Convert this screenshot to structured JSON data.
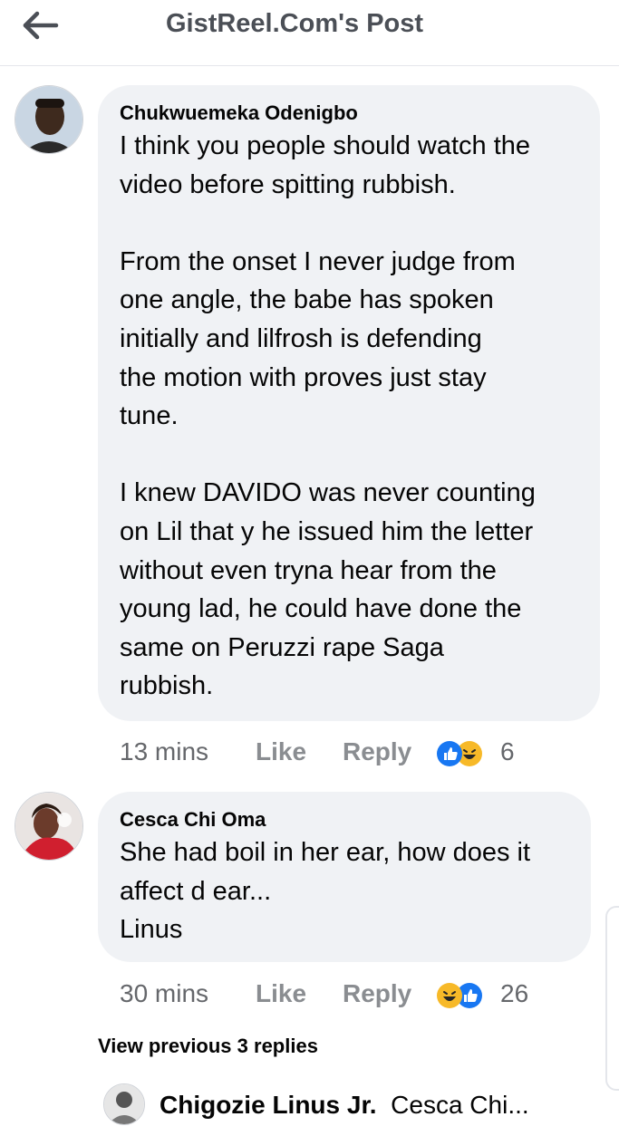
{
  "header": {
    "title": "GistReel.Com's Post"
  },
  "comments": [
    {
      "author": "Chukwuemeka Odenigbo",
      "text": "I think you people should watch the\nvideo before spitting rubbish.\n\nFrom the onset I never judge from\none angle, the babe has spoken\ninitially and lilfrosh is defending\nthe motion with proves just stay\ntune.\n\nI knew DAVIDO was never counting\non Lil that y he issued him the letter\nwithout even tryna hear from the\nyoung lad, he could have done the\nsame on Peruzzi rape Saga\nrubbish.",
      "time": "13 mins",
      "like": "Like",
      "reply": "Reply",
      "reaction_count": "6",
      "reactions": [
        "like-reaction-icon",
        "haha-reaction-icon"
      ]
    },
    {
      "author": "Cesca Chi Oma",
      "text": "She had boil in her ear, how does it\naffect d ear...\nLinus",
      "time": "30 mins",
      "like": "Like",
      "reply": "Reply",
      "reaction_count": "26",
      "reactions": [
        "haha-reaction-icon",
        "like-reaction-icon"
      ]
    }
  ],
  "replies": {
    "view_previous": "View previous 3 replies",
    "preview_author": "Chigozie Linus Jr.",
    "preview_text": "Cesca Chi..."
  },
  "colors": {
    "bubble": "#f0f2f5",
    "like_blue": "#1877f2",
    "haha_yellow": "#f7b928",
    "muted": "#65676b"
  }
}
